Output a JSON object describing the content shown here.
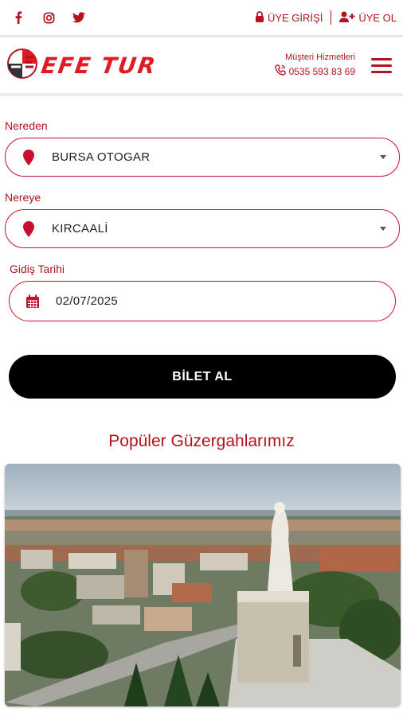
{
  "topbar": {
    "social": [
      {
        "name": "facebook-icon"
      },
      {
        "name": "instagram-icon"
      },
      {
        "name": "twitter-icon"
      }
    ],
    "login_label": "ÜYE GİRİŞİ",
    "register_label": "ÜYE OL"
  },
  "header": {
    "brand": "EFE TUR",
    "contact_title": "Müşteri Hizmetleri",
    "contact_phone": "0535 593 83 69"
  },
  "form": {
    "from_label": "Nereden",
    "from_value": "BURSA OTOGAR",
    "to_label": "Nereye",
    "to_value": "KIRCAALİ",
    "date_label": "Gidiş Tarihi",
    "date_value": "02/07/2025",
    "submit_label": "BİLET AL"
  },
  "routes": {
    "title": "Popüler Güzergahlarımız"
  },
  "colors": {
    "brand": "#e01b24",
    "accent": "#b3121f",
    "button": "#000000"
  }
}
